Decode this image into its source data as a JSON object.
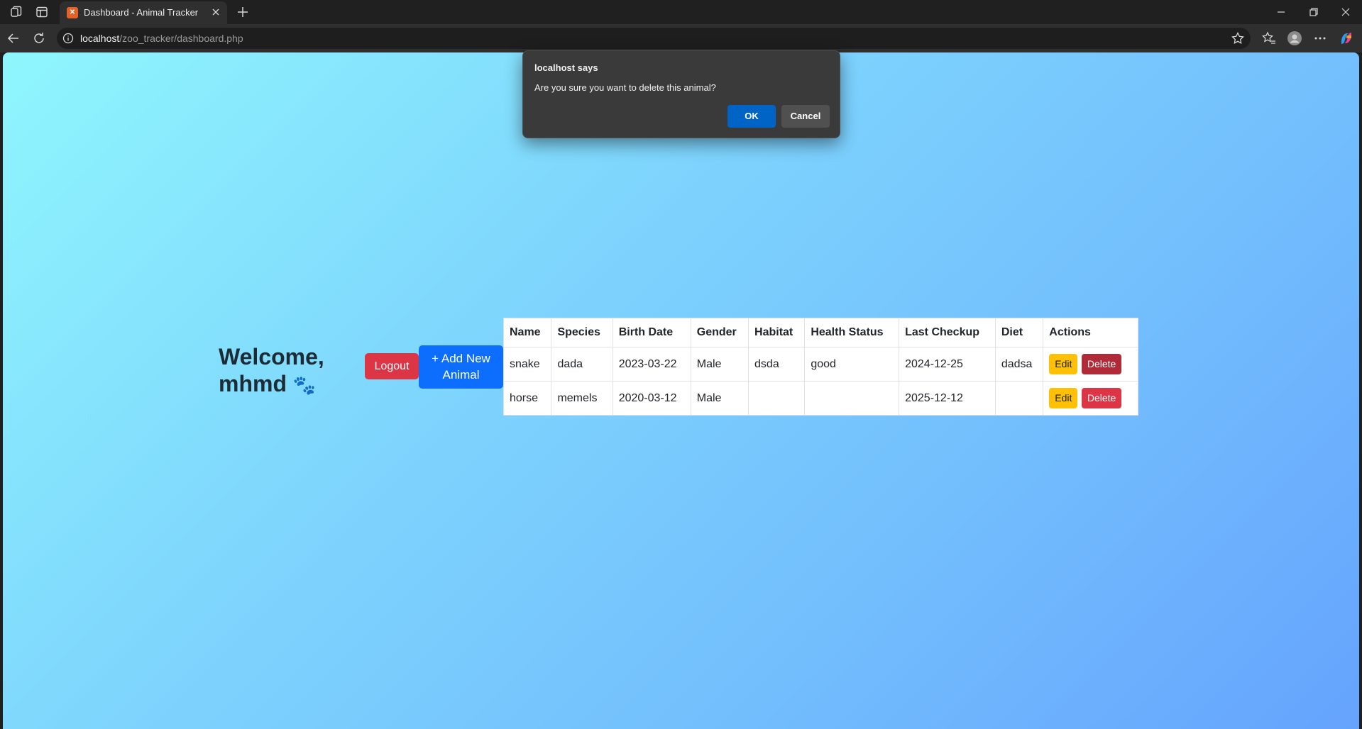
{
  "browser": {
    "tab_title": "Dashboard - Animal Tracker",
    "url_host": "localhost",
    "url_path": "/zoo_tracker/dashboard.php"
  },
  "page": {
    "welcome_line1": "Welcome,",
    "welcome_line2": "mhmd",
    "paw": "🐾",
    "logout_label": "Logout",
    "add_label_line1": "+ Add New",
    "add_label_line2": "Animal"
  },
  "table": {
    "headers": [
      "Name",
      "Species",
      "Birth Date",
      "Gender",
      "Habitat",
      "Health Status",
      "Last Checkup",
      "Diet",
      "Actions"
    ],
    "rows": [
      {
        "name": "snake",
        "species": "dada",
        "birth_date": "2023-03-22",
        "gender": "Male",
        "habitat": "dsda",
        "health_status": "good",
        "last_checkup": "2024-12-25",
        "diet": "dadsa",
        "edit": "Edit",
        "delete": "Delete"
      },
      {
        "name": "horse",
        "species": "memels",
        "birth_date": "2020-03-12",
        "gender": "Male",
        "habitat": "",
        "health_status": "",
        "last_checkup": "2025-12-12",
        "diet": "",
        "edit": "Edit",
        "delete": "Delete"
      }
    ]
  },
  "dialog": {
    "title": "localhost says",
    "message": "Are you sure you want to delete this animal?",
    "ok_label": "OK",
    "cancel_label": "Cancel"
  }
}
